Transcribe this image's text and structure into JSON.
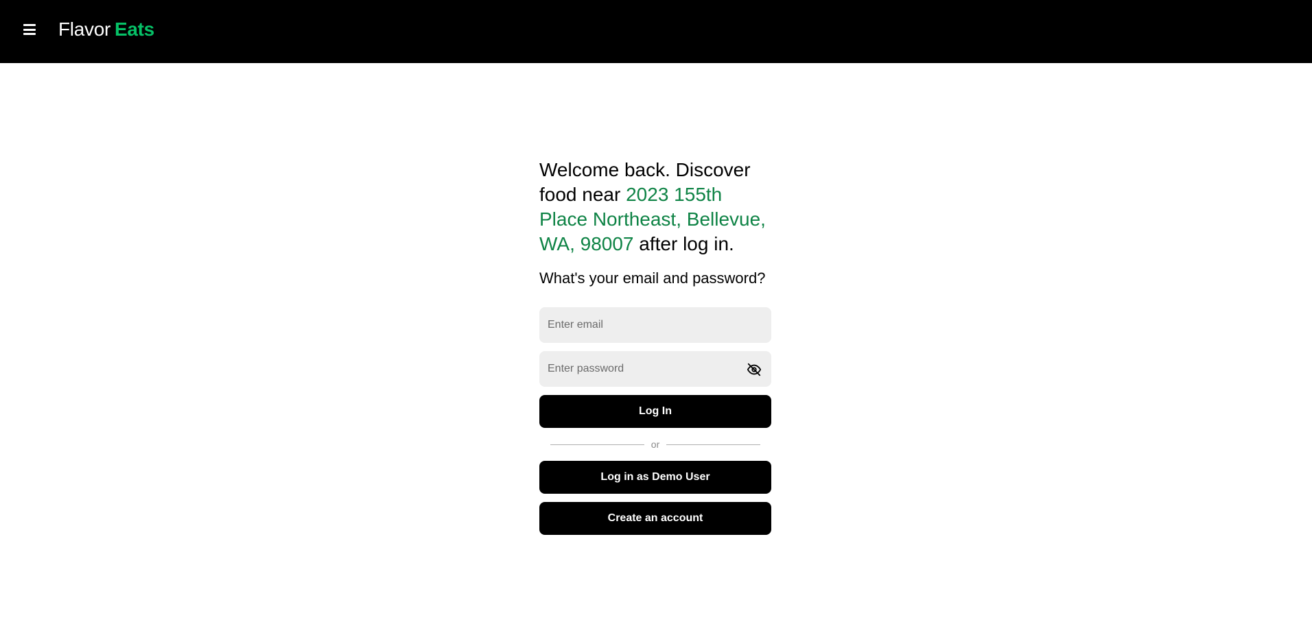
{
  "header": {
    "brand_first": "Flavor",
    "brand_second": "Eats",
    "menu_icon": "hamburger-menu-icon"
  },
  "login": {
    "welcome_prefix": "Welcome back. Discover food near",
    "address": "2023 155th Place Northeast, Bellevue, WA, 98007",
    "welcome_suffix": "after log in.",
    "question": "What's your email and password?",
    "email_placeholder": "Enter email",
    "password_placeholder": "Enter password",
    "password_toggle_icon": "eye-slash-icon",
    "login_label": "Log In",
    "divider_label": "or",
    "demo_label": "Log in as Demo User",
    "create_label": "Create an account"
  },
  "colors": {
    "header_bg": "#000000",
    "brand_accent": "#06c167",
    "address_text": "#0e8345",
    "input_bg": "#eeeeee",
    "button_bg": "#000000"
  }
}
